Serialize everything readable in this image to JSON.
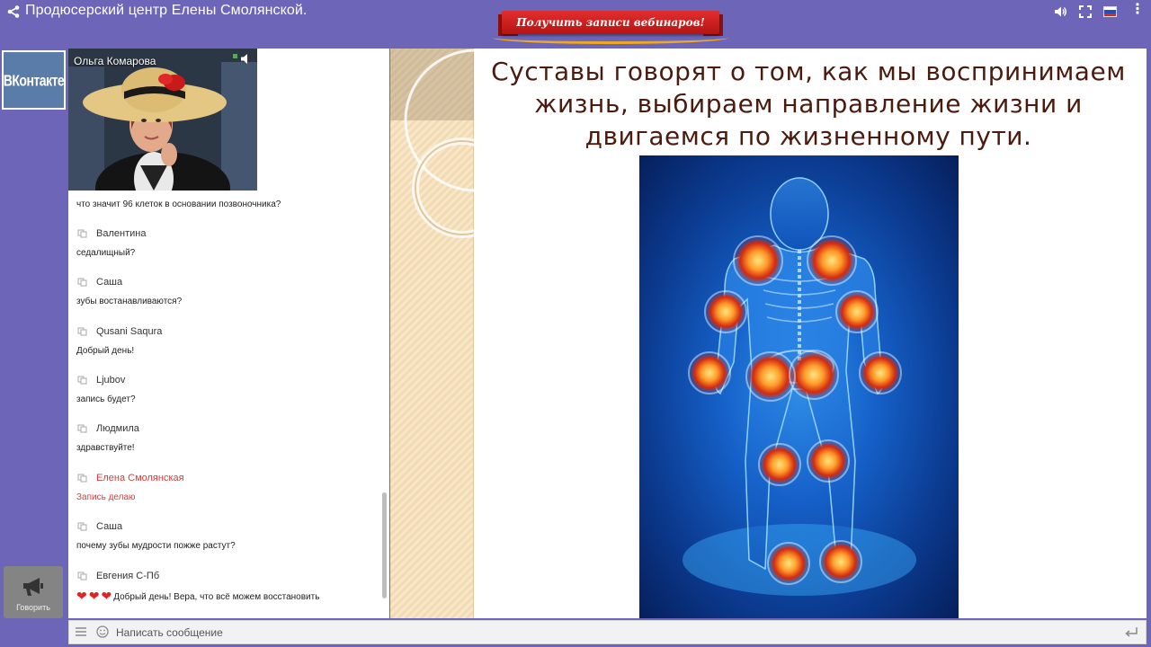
{
  "header": {
    "title": "Продюсерский центр Елены Смолянской.",
    "webinar_button": "Получить записи вебинаров!"
  },
  "sidebar": {
    "vk_label": "ВКонтакте",
    "speak_label": "Говорить"
  },
  "video": {
    "presenter_name": "Ольга Комарова"
  },
  "chat": {
    "messages": [
      {
        "user": "",
        "text": "что значит 96 клеток в основании позвоночника?"
      },
      {
        "user": "Валентина",
        "text": "седалищный?"
      },
      {
        "user": "Саша",
        "text": "зубы востанавливаются?"
      },
      {
        "user": "Qusani Saqura",
        "text": "Добрый день!"
      },
      {
        "user": "Ljubov",
        "text": "запись будет?"
      },
      {
        "user": "Людмила",
        "text": "здравствуйте!"
      },
      {
        "user": "Елена Смолянская",
        "text": "Запись делаю",
        "highlight": true
      },
      {
        "user": "Саша",
        "text": "почему зубы мудрости пожже растут?"
      },
      {
        "user": "Евгения С-Пб",
        "text": "Добрый день! Вера, что всё можем восстановить",
        "hearts": "❤❤❤"
      }
    ]
  },
  "slide": {
    "text": "Суставы говорят о том, как мы воспринимаем жизнь, выбираем направление жизни и двигаемся по жизненному пути."
  },
  "composer": {
    "placeholder": "Написать сообщение"
  },
  "colors": {
    "background": "#6c65b8",
    "moderator_name": "#d23c3c",
    "slide_title": "#4a1b0e",
    "webinar_red": "#d82020"
  }
}
